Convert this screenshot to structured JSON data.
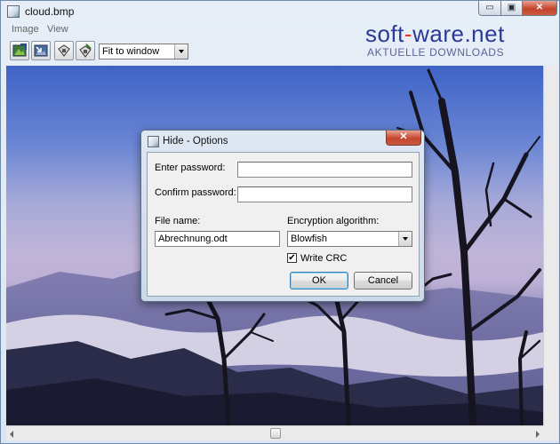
{
  "window": {
    "title": "cloud.bmp",
    "minimize_label": "▭",
    "maximize_label": "▣",
    "close_label": "✕"
  },
  "menu": [
    {
      "label": "Image"
    },
    {
      "label": "View"
    }
  ],
  "toolbar": {
    "buttons": [
      {
        "icon": "hide-image-icon"
      },
      {
        "icon": "extract-image-icon"
      },
      {
        "icon": "save-icon"
      },
      {
        "icon": "save-as-icon"
      }
    ],
    "zoom": {
      "value": "Fit to window"
    }
  },
  "watermark": {
    "brand_a": "soft",
    "brand_dash": "-",
    "brand_b": "ware.net",
    "tagline": "AKTUELLE DOWNLOADS"
  },
  "dialog": {
    "title": "Hide - Options",
    "close_label": "✕",
    "enter_password_label": "Enter password:",
    "enter_password_value": "",
    "confirm_password_label": "Confirm password:",
    "confirm_password_value": "",
    "file_name_label": "File name:",
    "file_name_value": "Abrechnung.odt",
    "encryption_label": "Encryption algorithm:",
    "encryption_value": "Blowfish",
    "write_crc_label": "Write CRC",
    "write_crc_checked": true,
    "ok_label": "OK",
    "cancel_label": "Cancel"
  },
  "colors": {
    "title_close": "#c4452d",
    "brand": "#2a3a96",
    "brand_dash": "#e32222"
  }
}
